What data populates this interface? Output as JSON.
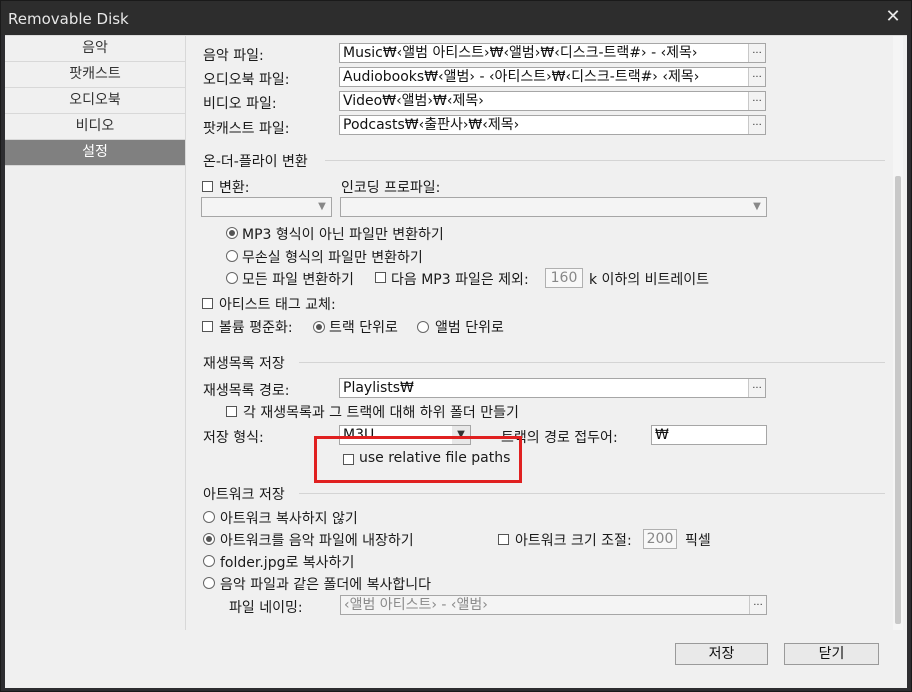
{
  "window": {
    "title": "Removable Disk",
    "close_glyph": "✕"
  },
  "sidebar": {
    "items": [
      {
        "label": "음악"
      },
      {
        "label": "팟캐스트"
      },
      {
        "label": "오디오북"
      },
      {
        "label": "비디오"
      },
      {
        "label": "설정",
        "active": true
      }
    ]
  },
  "paths": {
    "music_label": "음악 파일:",
    "music_value": "Music₩‹앨범 아티스트›₩‹앨범›₩‹디스크-트랙#› - ‹제목›",
    "audiobook_label": "오디오북 파일:",
    "audiobook_value": "Audiobooks₩‹앨범› - ‹아티스트›₩‹디스크-트랙#› ‹제목›",
    "video_label": "비디오 파일:",
    "video_value": "Video₩‹앨범›₩‹제목›",
    "podcast_label": "팟캐스트 파일:",
    "podcast_value": "Podcasts₩‹출판사›₩‹제목›",
    "browse_glyph": "..."
  },
  "onthefly": {
    "section": "온-더-플라이 변환",
    "convert_label": "변환:",
    "encoding_label": "인코딩 프로파일:",
    "opt_nonmp3": "MP3 형식이 아닌 파일만 변환하기",
    "opt_lossless": "무손실 형식의 파일만 변환하기",
    "opt_all": "모든 파일 변환하기",
    "except_mp3_label": "다음 MP3 파일은 제외:",
    "bitrate_value": "160",
    "bitrate_suffix": "k 이하의 비트레이트",
    "artist_tag_label": "아티스트 태그 교체:",
    "volume_label": "볼륨 평준화:",
    "vol_track": "트랙 단위로",
    "vol_album": "앨범 단위로"
  },
  "playlist": {
    "section": "재생목록 저장",
    "path_label": "재생목록 경로:",
    "path_value": "Playlists₩",
    "subfolder_label": "각 재생목록과 그 트랙에 대해 하위 폴더 만들기",
    "format_label": "저장 형식:",
    "format_value": "M3U",
    "prefix_label": "트랙의 경로 접두어:",
    "prefix_value": "₩",
    "relative_label": "use relative file paths"
  },
  "artwork": {
    "section": "아트워크 저장",
    "opt_none": "아트워크 복사하지 않기",
    "opt_embed": "아트워크를 음악 파일에 내장하기",
    "resize_label": "아트워크 크기 조절:",
    "resize_value": "200",
    "resize_unit": "픽셀",
    "opt_folderjpg": "folder.jpg로 복사하기",
    "opt_samefolder": "음악 파일과 같은 폴더에 복사합니다",
    "naming_label": "파일 네이밍:",
    "naming_value": "‹앨범 아티스트› - ‹앨범›"
  },
  "footer": {
    "save": "저장",
    "close": "닫기"
  },
  "colors": {
    "highlight": "#e02020",
    "sidebar_active": "#808080"
  }
}
